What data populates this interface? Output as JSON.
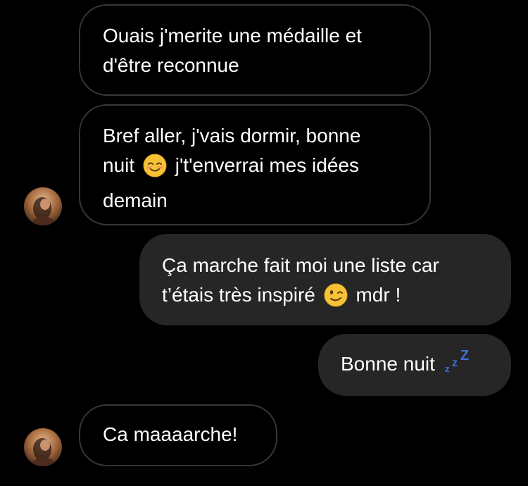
{
  "messages": [
    {
      "direction": "received",
      "lines": [
        "Ouais j'merite une médaille et",
        "d'être reconnue"
      ]
    },
    {
      "direction": "received",
      "line1": "Bref aller, j'vais dormir, bonne",
      "line2_before": "nuit",
      "line2_emoji": "smiling-blush-emoji",
      "line2_after": "j't'enverrai mes idées",
      "line3": "demain"
    },
    {
      "direction": "sent",
      "line1": "Ça marche fait moi une liste car",
      "line2_before": "t’étais très inspiré",
      "line2_emoji": "winking-face-emoji",
      "line2_after": "mdr !"
    },
    {
      "direction": "sent",
      "text": "Bonne nuit",
      "emoji": "zzz-emoji"
    },
    {
      "direction": "received",
      "text": "Ca maaaarche!"
    }
  ],
  "colors": {
    "background": "#000000",
    "received_border": "#363636",
    "sent_bubble": "#262626",
    "text": "#ffffff",
    "zzz": "#3b6fd8"
  }
}
